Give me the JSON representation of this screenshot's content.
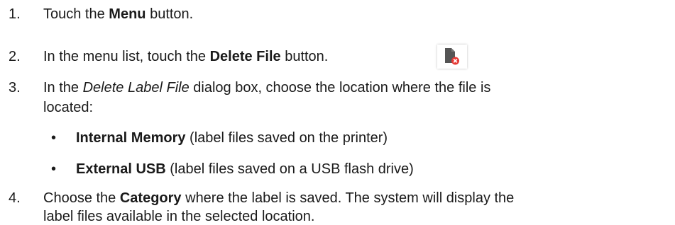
{
  "steps": [
    {
      "num": "1.",
      "pre": "Touch the ",
      "bold": "Menu",
      "post": " button."
    },
    {
      "num": "2.",
      "pre": "In the menu list, touch the ",
      "bold": "Delete File",
      "post": " button."
    },
    {
      "num": "3.",
      "pre": "In the ",
      "italic": "Delete Label File",
      "post": " dialog box, choose the location where the file is",
      "cont": "located:"
    },
    {
      "num": "4.",
      "pre": "Choose the ",
      "bold": "Category",
      "post": " where the label is saved. The system will display the",
      "cont": "label files available in the selected location."
    }
  ],
  "bullets": [
    {
      "symbol": "•",
      "bold": "Internal Memory",
      "post": " (label files saved on the printer)"
    },
    {
      "symbol": "•",
      "bold": "External USB",
      "post": " (label files saved on a USB flash drive)"
    }
  ],
  "icon": {
    "name": "delete-file-icon",
    "file_color": "#555555",
    "badge_color": "#e53935"
  }
}
